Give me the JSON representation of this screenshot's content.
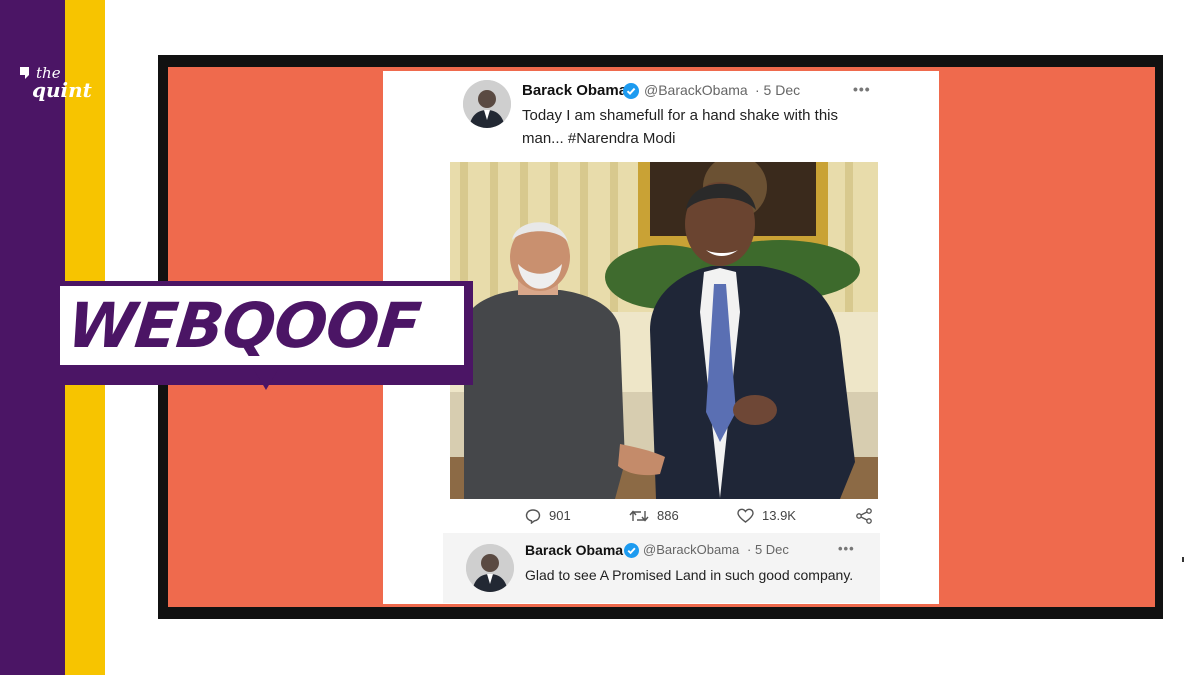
{
  "brand": {
    "the": "the",
    "name": "quint",
    "logo_icon": "quote-q-icon"
  },
  "badge": {
    "text": "WEBQOOF"
  },
  "tweet1": {
    "name": "Barack Obama",
    "handle": "@BarackObama",
    "date": "· 5 Dec",
    "more": "•••",
    "text_line1": "Today I am shamefull for a hand shake with this",
    "text_line2": "man... #Narendra Modi"
  },
  "actions": {
    "replies": "901",
    "retweets": "886",
    "likes": "13.9K"
  },
  "tweet2": {
    "name": "Barack Obama",
    "handle": "@BarackObama",
    "date": "· 5 Dec",
    "more": "•••",
    "text": "Glad to see A Promised Land in such good company."
  },
  "colors": {
    "purple": "#4b1565",
    "yellow": "#f7c400",
    "coral": "#ef6a4d",
    "verified": "#1d9bf0"
  }
}
